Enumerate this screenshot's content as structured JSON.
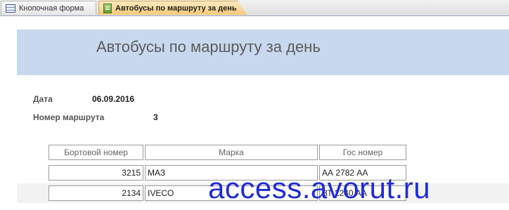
{
  "tabs": [
    {
      "label": "Кнопочная форма",
      "icon": "form-icon"
    },
    {
      "label": "Автобусы по маршруту за день",
      "icon": "report-icon",
      "active": true
    }
  ],
  "report": {
    "title": "Автобусы по маршруту за день",
    "date_label": "Дата",
    "date_value": "06.09.2016",
    "route_label": "Номер маршрута",
    "route_value": "3"
  },
  "table": {
    "headers": [
      "Бортовой номер",
      "Марка",
      "Гос номер"
    ],
    "rows": [
      [
        "3215",
        "МАЗ",
        "АА 2782 АА"
      ],
      [
        "2134",
        "IVECO",
        "ВТ 2240 АА"
      ]
    ]
  },
  "watermark": "access.avorut.ru"
}
